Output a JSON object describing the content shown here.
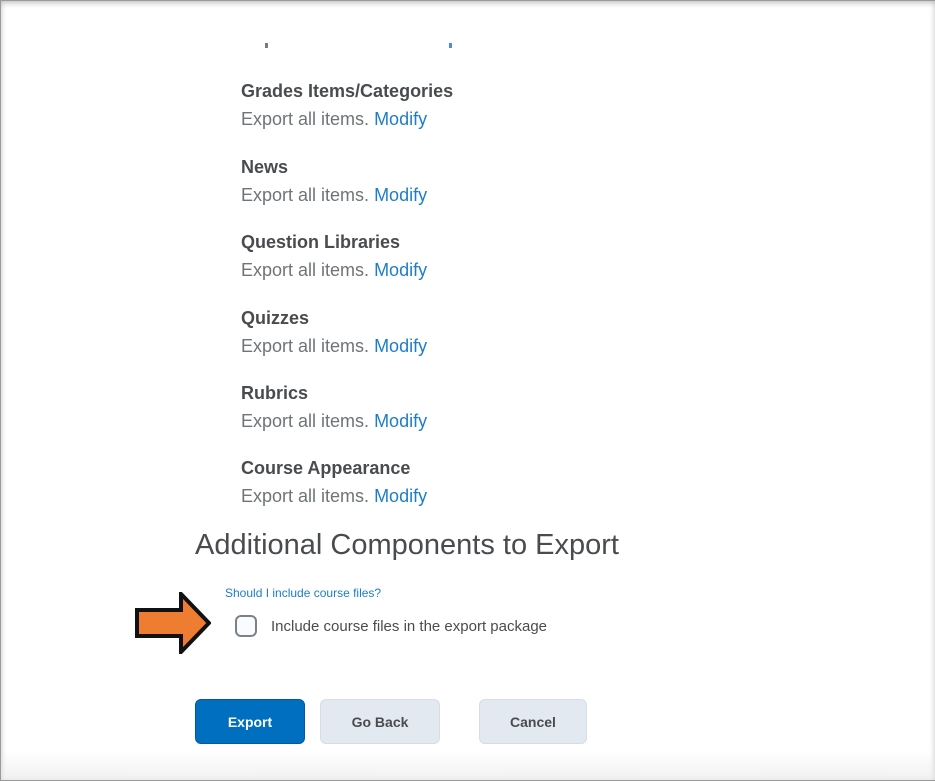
{
  "components": [
    {
      "title": "Grades Items/Categories",
      "desc": "Export all items.",
      "link": "Modify"
    },
    {
      "title": "News",
      "desc": "Export all items.",
      "link": "Modify"
    },
    {
      "title": "Question Libraries",
      "desc": "Export all items.",
      "link": "Modify"
    },
    {
      "title": "Quizzes",
      "desc": "Export all items.",
      "link": "Modify"
    },
    {
      "title": "Rubrics",
      "desc": "Export all items.",
      "link": "Modify"
    },
    {
      "title": "Course Appearance",
      "desc": "Export all items.",
      "link": "Modify"
    }
  ],
  "additional": {
    "heading": "Additional Components to Export",
    "help_link": "Should I include course files?",
    "checkbox_label": "Include course files in the export package",
    "checkbox_checked": false
  },
  "buttons": {
    "export": "Export",
    "go_back": "Go Back",
    "cancel": "Cancel"
  },
  "colors": {
    "link": "#1c7ec8",
    "primary": "#006fbf",
    "arrow": "#ee7d31"
  },
  "icons": {
    "pointer_arrow": "right-arrow-icon"
  }
}
